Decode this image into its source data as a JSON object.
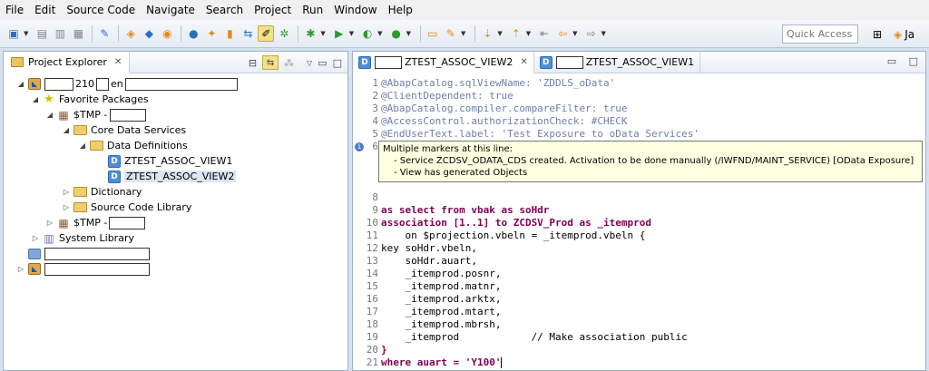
{
  "menu": [
    "File",
    "Edit",
    "Source Code",
    "Navigate",
    "Search",
    "Project",
    "Run",
    "Window",
    "Help"
  ],
  "toolbar": {
    "quick_access_placeholder": "Quick Access",
    "perspective_label": "Ja"
  },
  "project_explorer": {
    "tab_label": "Project Explorer",
    "tree": [
      {
        "label_mid": "210",
        "label_sep": "en",
        "indent": 0,
        "expanded": true
      },
      {
        "label": "Favorite Packages",
        "indent": 1
      },
      {
        "label": "$TMP -",
        "indent": 2
      },
      {
        "label": "Core Data Services",
        "indent": 3
      },
      {
        "label": "Data Definitions",
        "indent": 4
      },
      {
        "label": "ZTEST_ASSOC_VIEW1",
        "indent": 5
      },
      {
        "label": "ZTEST_ASSOC_VIEW2",
        "indent": 5,
        "selected": true
      },
      {
        "label": "Dictionary",
        "indent": 3
      },
      {
        "label": "Source Code Library",
        "indent": 3
      },
      {
        "label": "$TMP -",
        "indent": 2
      },
      {
        "label": "System Library",
        "indent": 1
      }
    ]
  },
  "editor": {
    "tabs": [
      {
        "label": "ZTEST_ASSOC_VIEW2",
        "active": true
      },
      {
        "label": "ZTEST_ASSOC_VIEW1",
        "active": false
      }
    ],
    "lines": [
      {
        "n": "1",
        "text": "@AbapCatalog.sqlViewName: 'ZDDLS_oData'"
      },
      {
        "n": "2",
        "text": "@ClientDependent: true"
      },
      {
        "n": "3",
        "text": "@AbapCatalog.compiler.compareFilter: true"
      },
      {
        "n": "4",
        "text": "@AccessControl.authorizationCheck: #CHECK"
      },
      {
        "n": "5",
        "text": "@EndUserText.label: 'Test Exposure to oData Services'"
      },
      {
        "n": "6",
        "text": ""
      },
      {
        "n": "8",
        "text": ""
      },
      {
        "n": "9",
        "text": "as select from vbak as soHdr"
      },
      {
        "n": "10",
        "text": "association [1..1] to ZCDSV_Prod as _itemprod"
      },
      {
        "n": "11",
        "text": "    on $projection.vbeln = _itemprod.vbeln {"
      },
      {
        "n": "12",
        "text": "key soHdr.vbeln,"
      },
      {
        "n": "13",
        "text": "    soHdr.auart,"
      },
      {
        "n": "14",
        "text": "    _itemprod.posnr,"
      },
      {
        "n": "15",
        "text": "    _itemprod.matnr,"
      },
      {
        "n": "16",
        "text": "    _itemprod.arktx,"
      },
      {
        "n": "17",
        "text": "    _itemprod.mtart,"
      },
      {
        "n": "18",
        "text": "    _itemprod.mbrsh,"
      },
      {
        "n": "19",
        "text": "    _itemprod            // Make association public"
      },
      {
        "n": "20",
        "text": "}"
      },
      {
        "n": "21",
        "text": "where auart = 'Y100'"
      }
    ],
    "tooltip": {
      "title": "Multiple markers at this line:",
      "items": [
        "- Service ZCDSV_ODATA_CDS created. Activation to be done manually (/IWFND/MAINT_SERVICE) [OData Exposure]",
        "- View has generated Objects"
      ]
    }
  }
}
